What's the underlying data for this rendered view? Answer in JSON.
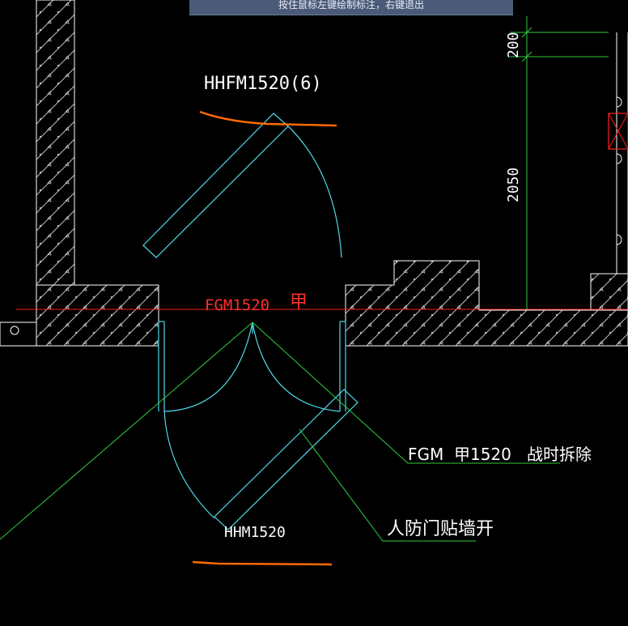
{
  "prompt": {
    "text": "按住鼠标左键绘制标注，右键退出"
  },
  "annotations": {
    "top_door_label": "HHFM1520(6)",
    "wall_door_label": "FGM1520",
    "wall_door_grade": "甲",
    "right_note_1": "FGM  甲1520   战时拆除",
    "right_note_2": "人防门贴墙开",
    "bottom_door_label": "HHM1520"
  },
  "dimensions": {
    "small": "200",
    "large": "2050"
  },
  "colors": {
    "background": "#000000",
    "wall_outline": "#ffffff",
    "hatch": "#c8c8c8",
    "axis_line": "#ff2020",
    "door": "#4fd8e8",
    "leader": "#2ecc40",
    "highlight": "#ff6a00",
    "label_text": "#ffffff",
    "axis_text": "#ff3030"
  }
}
